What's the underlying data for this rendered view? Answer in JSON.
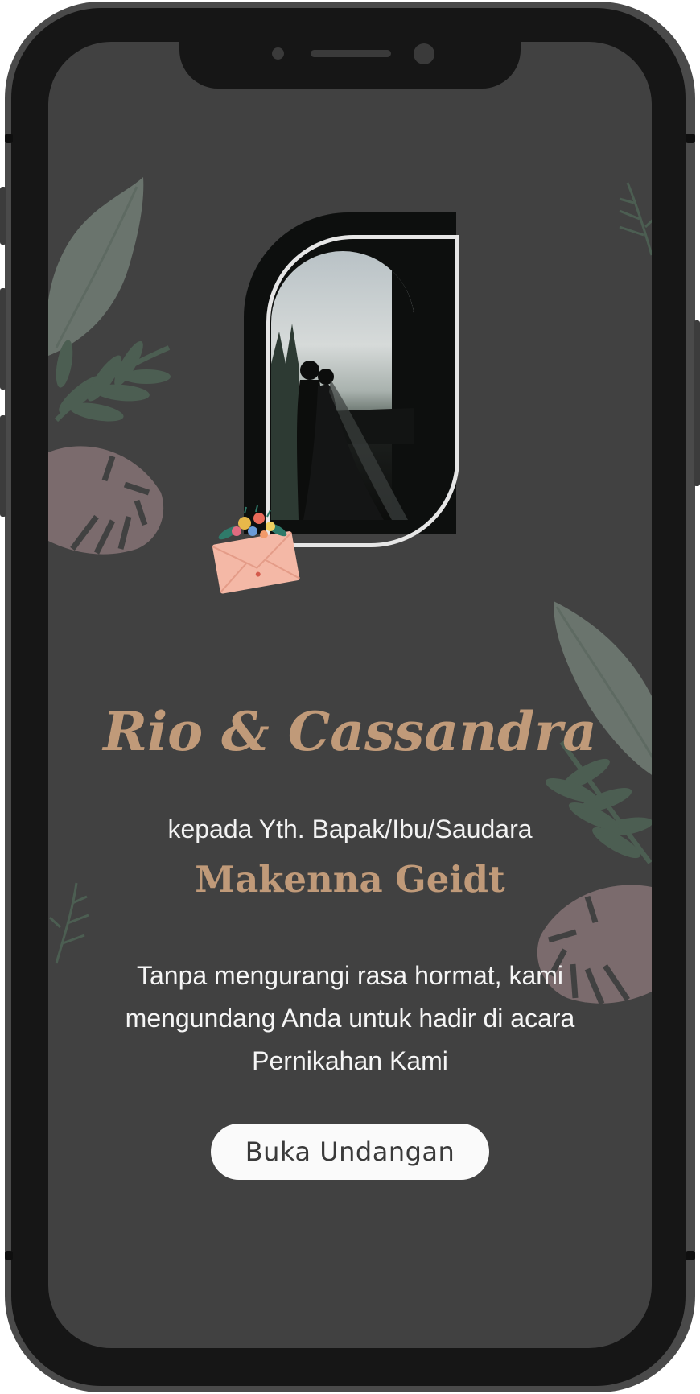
{
  "couple": {
    "names": "Rio & Cassandra"
  },
  "invitation": {
    "greeting": "kepada Yth. Bapak/Ibu/Saudara",
    "guest_name": "Makenna Geidt",
    "message": "Tanpa mengurangi rasa hormat, kami mengundang Anda untuk hadir di acara Pernikahan Kami",
    "open_button_label": "Buka Undangan"
  },
  "icons": {
    "envelope": "envelope-with-flowers-icon",
    "leaf": "leaf-icon",
    "monstera": "monstera-leaf-icon",
    "fern": "fern-icon"
  },
  "colors": {
    "screen_background": "#414141",
    "accent": "#c09a79",
    "text": "#f2f2f2",
    "button_background": "#fafafa",
    "button_text": "#3a3a3a"
  }
}
